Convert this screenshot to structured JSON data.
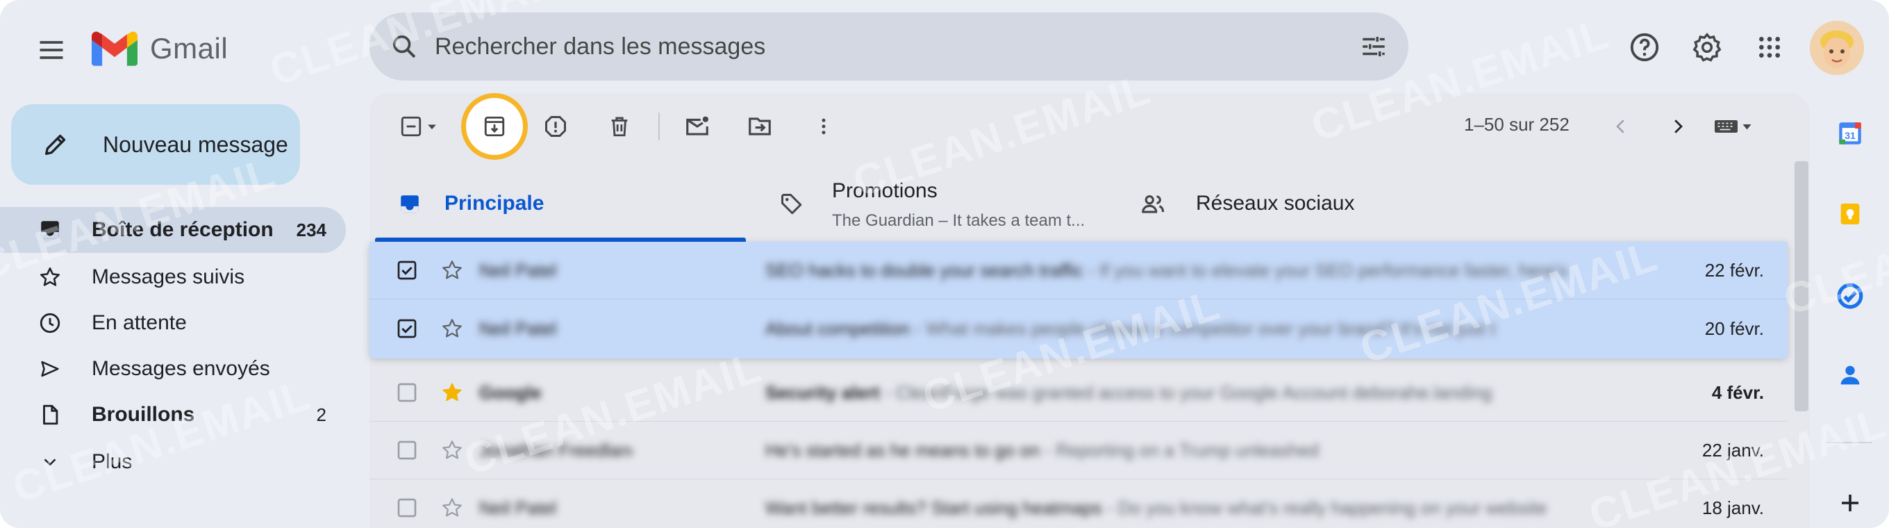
{
  "app": {
    "name": "Gmail"
  },
  "search": {
    "placeholder": "Rechercher dans les messages"
  },
  "compose": {
    "label": "Nouveau message"
  },
  "nav": [
    {
      "label": "Boîte de réception",
      "count": "234",
      "icon": "inbox-icon",
      "active": true
    },
    {
      "label": "Messages suivis",
      "count": "",
      "icon": "star-icon"
    },
    {
      "label": "En attente",
      "count": "",
      "icon": "clock-icon"
    },
    {
      "label": "Messages envoyés",
      "count": "",
      "icon": "send-icon"
    },
    {
      "label": "Brouillons",
      "count": "2",
      "icon": "draft-icon",
      "bold": true
    },
    {
      "label": "Plus",
      "count": "",
      "icon": "chevron-down-icon"
    }
  ],
  "toolbar": {
    "pager": "1–50 sur 252"
  },
  "tabs": [
    {
      "label": "Principale",
      "sub": "",
      "icon": "inbox-tab-icon",
      "active": true
    },
    {
      "label": "Promotions",
      "sub": "The Guardian – It takes a team t...",
      "icon": "tag-icon"
    },
    {
      "label": "Réseaux sociaux",
      "sub": "",
      "icon": "people-icon"
    }
  ],
  "emails": [
    {
      "sender": "Neil Patel",
      "subject": "SEO hacks to double your search traffic",
      "snippet": " - If you want to elevate your SEO performance faster, here's",
      "date": "22 févr.",
      "selected": true,
      "starred": false,
      "unread": false
    },
    {
      "sender": "Neil Patel",
      "subject": "About competition",
      "snippet": " - What makes people choose a competitor over your brand? It's not just t",
      "date": "20 févr.",
      "selected": true,
      "starred": false,
      "unread": false
    },
    {
      "sender": "Google",
      "subject": "Security alert",
      "snippet": " - CleanForge was granted access to your Google Account deborahe.landing",
      "date": "4 févr.",
      "selected": false,
      "starred": true,
      "unread": true
    },
    {
      "sender": "Jonathan Freedland",
      "subject": "He's started as he means to go on",
      "snippet": " - Reporting on a Trump unleashed",
      "date": "22 janv.",
      "selected": false,
      "starred": false,
      "unread": false
    },
    {
      "sender": "Neil Patel",
      "subject": "Want better results? Start using heatmaps",
      "snippet": " - Do you know what's really happening on your website",
      "date": "18 janv.",
      "selected": false,
      "starred": false,
      "unread": false
    }
  ],
  "watermark": "CLEAN.EMAIL",
  "colors": {
    "accent": "#0b57d0",
    "highlight": "#f7b529",
    "selected_row": "#c5d9f8",
    "compose": "#c2dcf0"
  }
}
